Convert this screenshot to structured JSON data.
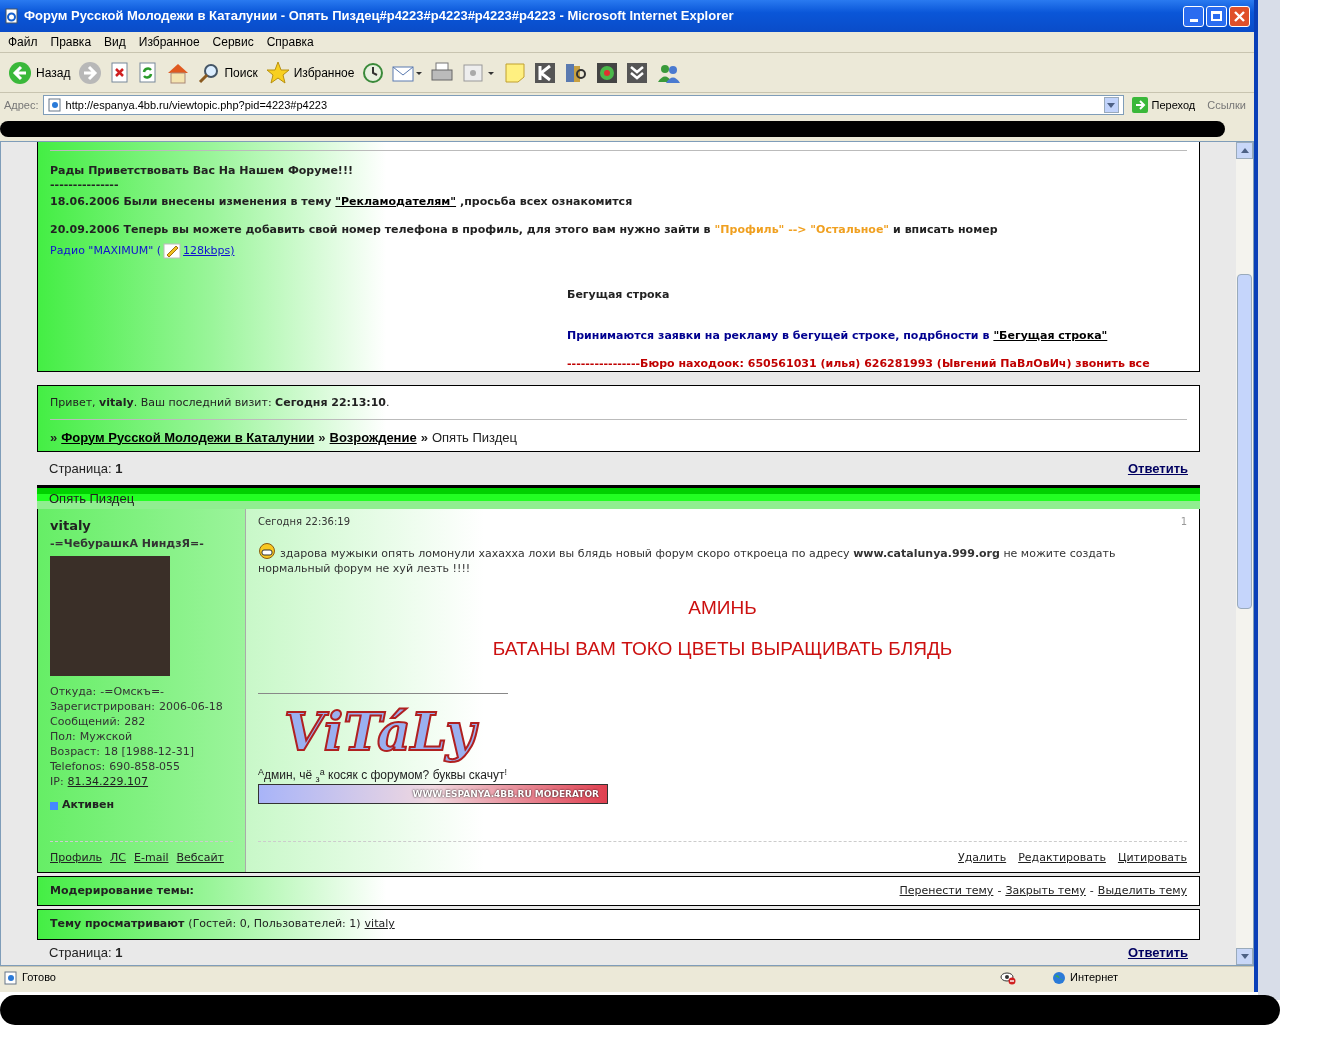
{
  "window": {
    "title": "Форум Русской Молодежи в Каталунии - Опять Пиздец#p4223#p4223#p4223#p4223 - Microsoft Internet Explorer"
  },
  "menu": [
    "Файл",
    "Правка",
    "Вид",
    "Избранное",
    "Сервис",
    "Справка"
  ],
  "toolbar": [
    {
      "kind": "back",
      "label": "Назад"
    },
    {
      "kind": "forward"
    },
    {
      "kind": "stop"
    },
    {
      "kind": "refresh"
    },
    {
      "kind": "home"
    },
    {
      "kind": "search",
      "label": "Поиск"
    },
    {
      "kind": "favorites",
      "label": "Избранное"
    },
    {
      "kind": "history"
    },
    {
      "kind": "mail"
    },
    {
      "kind": "print"
    },
    {
      "kind": "edit"
    },
    {
      "kind": "note"
    },
    {
      "kind": "k"
    },
    {
      "kind": "research"
    },
    {
      "kind": "flower"
    },
    {
      "kind": "chevrons"
    },
    {
      "kind": "people"
    }
  ],
  "address": {
    "label": "Адрес:",
    "value": "http://espanya.4bb.ru/viewtopic.php?pid=4223#p4223",
    "go": "Переход",
    "links": "Ссылки"
  },
  "announcements": {
    "welcome": "Рады Приветствовать Вас На Нашем Форуме!!!",
    "divider": "---------------",
    "lines": [
      [
        {
          "kind": "bold",
          "text": "18.06.2006 Были внесены изменения в тему"
        },
        {
          "kind": "link",
          "text": "\"Рекламодателям\""
        },
        {
          "kind": "bold",
          "text": ",просьба всех ознакомится"
        }
      ],
      [
        {
          "kind": "bold",
          "text": "20.09.2006 Теперь вы можете добавить свой номер телефона в профиль, для этого вам нужно зайти в"
        },
        {
          "kind": "orange",
          "text": "\"Профиль\" --> \"Остальное\""
        },
        {
          "kind": "bold",
          "text": "и вписать номер"
        }
      ]
    ],
    "radio": {
      "label": "Радио \"MAXIMUM\" (",
      "link": "128kbps)"
    }
  },
  "ticker": {
    "title": "Бегущая строка",
    "notice": "Принимаются заявки на рекламу в бегущей строке, подрбности в",
    "notice_link": "\"Бегущая строка\"",
    "lost_found": "----------------Бюро находоок: 650561031 (илья) 626281993 (Ывгений ПаВлОвИч) звонить все"
  },
  "greeting": "Привет, **vitaly**.  Ваш последний визит: **Сегодня 22:13:10**.",
  "breadcrumb_separator": "»",
  "breadcrumbs": [
    {
      "text": "Форум Русской Молодежи в Каталунии",
      "link": true
    },
    {
      "text": "Возрождение",
      "link": true
    },
    {
      "text": "Опять Пиздец",
      "link": false
    }
  ],
  "pager_top": {
    "label": "Страница:",
    "page": "1",
    "reply": "Ответить"
  },
  "topic_title": "Опять Пиздец",
  "post": {
    "author": "vitaly",
    "user_title": "-=ЧебурашкА НиндзЯ=-",
    "info": [
      {
        "label": "Откуда:",
        "value": "-=Омскъ=-",
        "link": false
      },
      {
        "label": "Зарегистрирован:",
        "value": "2006-06-18",
        "link": false
      },
      {
        "label": "Сообщений:",
        "value": "282",
        "link": false
      },
      {
        "label": "Пол:",
        "value": "Мужской",
        "link": false
      },
      {
        "label": "Возраст:",
        "value": "18 [1988-12-31]",
        "link": false
      },
      {
        "label": "Telefonos:",
        "value": "690-858-055",
        "link": false
      },
      {
        "label": "IP:",
        "value": "81.34.229.107",
        "link": true
      }
    ],
    "status": {
      "text": "Активен",
      "online": true
    },
    "date": "Сегодня 22:36:19",
    "number": "1",
    "body": "здарова мужыки опять ломонули хахахха лохи вы блядь новый форум скоро откроеца по адресу **www.catalunya.999.org** не можите создать нормальный форум не хуй лезть !!!!",
    "big_lines": [
      "АМИНЬ",
      "БАТАНЫ ВАМ ТОКО ЦВЕТЫ ВЫРАЩИВАТЬ БЛЯДЬ"
    ],
    "signature_logo": "ViTáLy",
    "signature_text": "$^{А}$дмин, чё $_{з}$$^{а}$ косяк с форумом? буквы скачут$^{!}$",
    "signature_banner": "WWW.ESPANYA.4BB.RU  MODERATOR",
    "user_links": [
      "Профиль",
      "ЛС",
      "E-mail",
      "Вебсайт"
    ],
    "actions": [
      "Удалить",
      "Редактировать",
      "Цитировать"
    ]
  },
  "moderation": {
    "label": "Модерирование темы:",
    "actions": [
      "Перенести тему",
      "Закрыть тему",
      "Выделить тему"
    ],
    "separator": "-"
  },
  "viewers": {
    "label": "Тему просматривают",
    "counts": "(Гостей: 0, Пользователей: 1)",
    "users": [
      "vitaly"
    ]
  },
  "pager_bottom": {
    "label": "Страница:",
    "page": "1",
    "reply": "Ответить"
  },
  "status_bar": {
    "text": "Готово",
    "zone": "Интернет"
  }
}
